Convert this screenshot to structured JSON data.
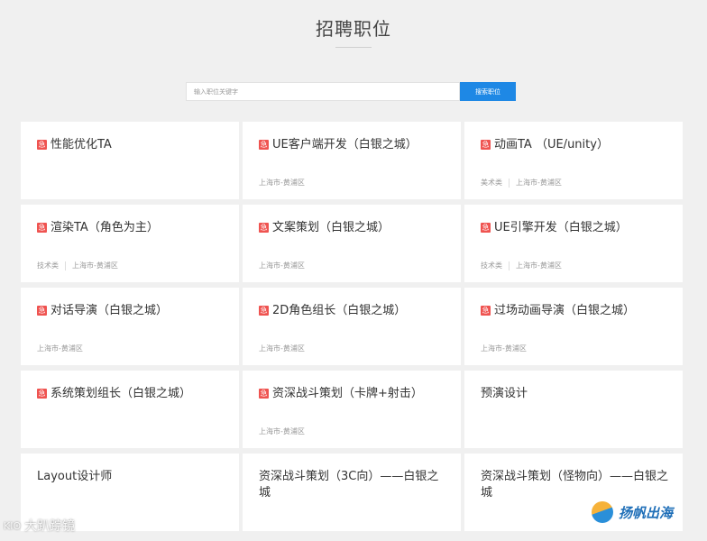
{
  "header": {
    "title": "招聘职位"
  },
  "search": {
    "placeholder": "输入职位关键字",
    "button_label": "搜索职位"
  },
  "urgent_badge": "急",
  "jobs": [
    {
      "title": "性能优化TA",
      "urgent": true,
      "category": "",
      "location": ""
    },
    {
      "title": "UE客户端开发（白银之城）",
      "urgent": true,
      "category": "",
      "location": "上海市-黄浦区"
    },
    {
      "title": "动画TA （UE/unity）",
      "urgent": true,
      "category": "美术类",
      "location": "上海市-黄浦区"
    },
    {
      "title": "渲染TA（角色为主）",
      "urgent": true,
      "category": "技术类",
      "location": "上海市-黄浦区"
    },
    {
      "title": "文案策划（白银之城）",
      "urgent": true,
      "category": "",
      "location": "上海市-黄浦区"
    },
    {
      "title": "UE引擎开发（白银之城）",
      "urgent": true,
      "category": "技术类",
      "location": "上海市-黄浦区"
    },
    {
      "title": "对话导演（白银之城）",
      "urgent": true,
      "category": "",
      "location": "上海市-黄浦区"
    },
    {
      "title": "2D角色组长（白银之城）",
      "urgent": true,
      "category": "",
      "location": "上海市-黄浦区"
    },
    {
      "title": "过场动画导演（白银之城）",
      "urgent": true,
      "category": "",
      "location": "上海市-黄浦区"
    },
    {
      "title": "系统策划组长（白银之城）",
      "urgent": true,
      "category": "",
      "location": ""
    },
    {
      "title": "资深战斗策划（卡牌+射击）",
      "urgent": true,
      "category": "",
      "location": "上海市-黄浦区"
    },
    {
      "title": "预演设计",
      "urgent": false,
      "category": "",
      "location": ""
    },
    {
      "title": "Layout设计师",
      "urgent": false,
      "category": "",
      "location": ""
    },
    {
      "title": "资深战斗策划（3C向）——白银之城",
      "urgent": false,
      "category": "",
      "location": ""
    },
    {
      "title": "资深战斗策划（怪物向）——白银之城",
      "urgent": false,
      "category": "",
      "location": ""
    }
  ],
  "watermarks": {
    "left": "大趴踪镜",
    "left_logo": "KIO",
    "right": "扬帆出海"
  },
  "colors": {
    "accent": "#1e88e5",
    "urgent": "#ef5350",
    "background": "#f0f0f0"
  }
}
